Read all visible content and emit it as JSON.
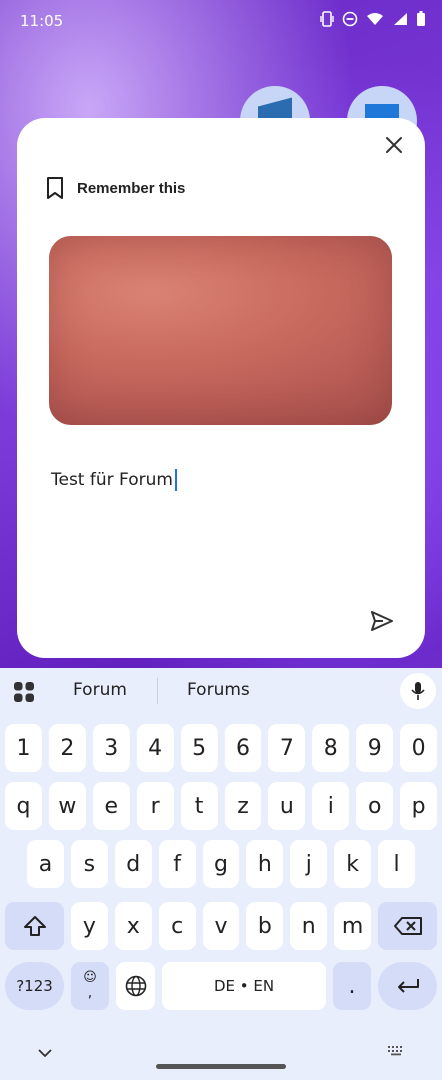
{
  "status_bar": {
    "time": "11:05"
  },
  "card": {
    "title": "Remember this",
    "text_value": "Test für Forum"
  },
  "keyboard": {
    "suggestions": [
      "Forum",
      "Forums"
    ],
    "number_row": [
      "1",
      "2",
      "3",
      "4",
      "5",
      "6",
      "7",
      "8",
      "9",
      "0"
    ],
    "row1": [
      "q",
      "w",
      "e",
      "r",
      "t",
      "z",
      "u",
      "i",
      "o",
      "p"
    ],
    "row2": [
      "a",
      "s",
      "d",
      "f",
      "g",
      "h",
      "j",
      "k",
      "l"
    ],
    "row3": [
      "y",
      "x",
      "c",
      "v",
      "b",
      "n",
      "m"
    ],
    "symbols_label": "?123",
    "comma_label": ",",
    "space_label": "DE • EN",
    "period_label": "."
  }
}
